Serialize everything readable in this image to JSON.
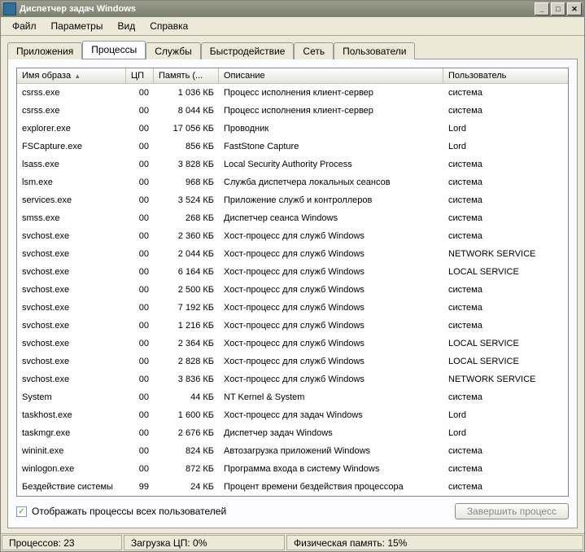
{
  "window": {
    "title": "Диспетчер задач Windows",
    "buttons": {
      "min": "_",
      "max": "□",
      "close": "✕"
    }
  },
  "menu": {
    "file": "Файл",
    "options": "Параметры",
    "view": "Вид",
    "help": "Справка"
  },
  "tabs": {
    "apps": "Приложения",
    "processes": "Процессы",
    "services": "Службы",
    "performance": "Быстродействие",
    "networking": "Сеть",
    "users": "Пользователи"
  },
  "columns": {
    "image": "Имя образа",
    "cpu": "ЦП",
    "memory": "Память (...",
    "description": "Описание",
    "user": "Пользователь"
  },
  "rows": [
    {
      "image": "csrss.exe",
      "cpu": "00",
      "mem": "1 036 КБ",
      "desc": "Процесс исполнения клиент-сервер",
      "user": "система"
    },
    {
      "image": "csrss.exe",
      "cpu": "00",
      "mem": "8 044 КБ",
      "desc": "Процесс исполнения клиент-сервер",
      "user": "система"
    },
    {
      "image": "explorer.exe",
      "cpu": "00",
      "mem": "17 056 КБ",
      "desc": "Проводник",
      "user": "Lord"
    },
    {
      "image": "FSCapture.exe",
      "cpu": "00",
      "mem": "856 КБ",
      "desc": "FastStone Capture",
      "user": "Lord"
    },
    {
      "image": "lsass.exe",
      "cpu": "00",
      "mem": "3 828 КБ",
      "desc": "Local Security Authority Process",
      "user": "система"
    },
    {
      "image": "lsm.exe",
      "cpu": "00",
      "mem": "968 КБ",
      "desc": "Служба диспетчера локальных сеансов",
      "user": "система"
    },
    {
      "image": "services.exe",
      "cpu": "00",
      "mem": "3 524 КБ",
      "desc": "Приложение служб и контроллеров",
      "user": "система"
    },
    {
      "image": "smss.exe",
      "cpu": "00",
      "mem": "268 КБ",
      "desc": "Диспетчер сеанса  Windows",
      "user": "система"
    },
    {
      "image": "svchost.exe",
      "cpu": "00",
      "mem": "2 360 КБ",
      "desc": "Хост-процесс для служб Windows",
      "user": "система"
    },
    {
      "image": "svchost.exe",
      "cpu": "00",
      "mem": "2 044 КБ",
      "desc": "Хост-процесс для служб Windows",
      "user": "NETWORK SERVICE"
    },
    {
      "image": "svchost.exe",
      "cpu": "00",
      "mem": "6 164 КБ",
      "desc": "Хост-процесс для служб Windows",
      "user": "LOCAL SERVICE"
    },
    {
      "image": "svchost.exe",
      "cpu": "00",
      "mem": "2 500 КБ",
      "desc": "Хост-процесс для служб Windows",
      "user": "система"
    },
    {
      "image": "svchost.exe",
      "cpu": "00",
      "mem": "7 192 КБ",
      "desc": "Хост-процесс для служб Windows",
      "user": "система"
    },
    {
      "image": "svchost.exe",
      "cpu": "00",
      "mem": "1 216 КБ",
      "desc": "Хост-процесс для служб Windows",
      "user": "система"
    },
    {
      "image": "svchost.exe",
      "cpu": "00",
      "mem": "2 364 КБ",
      "desc": "Хост-процесс для служб Windows",
      "user": "LOCAL SERVICE"
    },
    {
      "image": "svchost.exe",
      "cpu": "00",
      "mem": "2 828 КБ",
      "desc": "Хост-процесс для служб Windows",
      "user": "LOCAL SERVICE"
    },
    {
      "image": "svchost.exe",
      "cpu": "00",
      "mem": "3 836 КБ",
      "desc": "Хост-процесс для служб Windows",
      "user": "NETWORK SERVICE"
    },
    {
      "image": "System",
      "cpu": "00",
      "mem": "44 КБ",
      "desc": "NT Kernel & System",
      "user": "система"
    },
    {
      "image": "taskhost.exe",
      "cpu": "00",
      "mem": "1 600 КБ",
      "desc": "Хост-процесс для задач Windows",
      "user": "Lord"
    },
    {
      "image": "taskmgr.exe",
      "cpu": "00",
      "mem": "2 676 КБ",
      "desc": "Диспетчер задач Windows",
      "user": "Lord"
    },
    {
      "image": "wininit.exe",
      "cpu": "00",
      "mem": "824 КБ",
      "desc": "Автозагрузка приложений Windows",
      "user": "система"
    },
    {
      "image": "winlogon.exe",
      "cpu": "00",
      "mem": "872 КБ",
      "desc": "Программа входа в систему Windows",
      "user": "система"
    },
    {
      "image": "Бездействие системы",
      "cpu": "99",
      "mem": "24 КБ",
      "desc": "Процент времени бездействия процессора",
      "user": "система"
    }
  ],
  "checkbox": {
    "show_all_users": "Отображать процессы всех пользователей",
    "checked_glyph": "✓"
  },
  "buttons": {
    "end_process": "Завершить процесс"
  },
  "status": {
    "processes": "Процессов: 23",
    "cpu": "Загрузка ЦП: 0%",
    "mem": "Физическая память: 15%"
  }
}
